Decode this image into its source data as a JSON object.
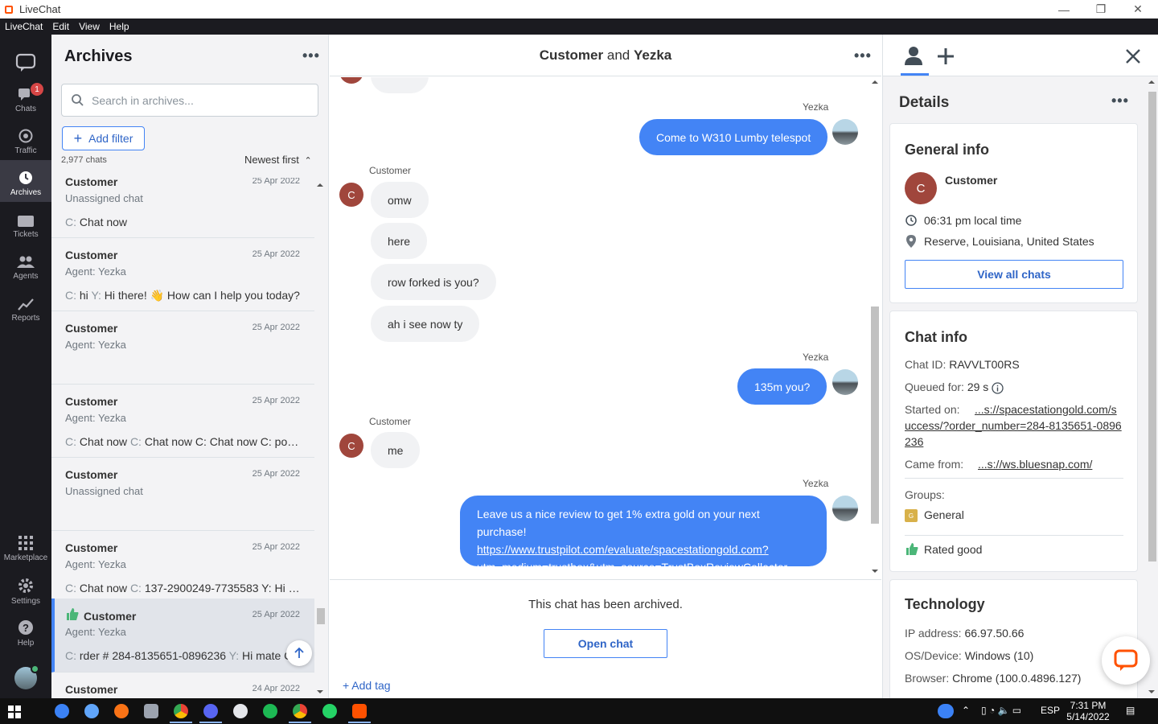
{
  "window": {
    "title": "LiveChat",
    "controls": [
      "—",
      "❐",
      "✕"
    ]
  },
  "menu": [
    "LiveChat",
    "Edit",
    "View",
    "Help"
  ],
  "nav": {
    "items": [
      {
        "label": "Chats",
        "badge": "1"
      },
      {
        "label": "Traffic"
      },
      {
        "label": "Archives"
      },
      {
        "label": "Tickets"
      },
      {
        "label": "Agents"
      },
      {
        "label": "Reports"
      },
      {
        "label": "Marketplace"
      },
      {
        "label": "Settings"
      },
      {
        "label": "Help"
      }
    ],
    "active": "Archives"
  },
  "archives": {
    "title": "Archives",
    "menu_dots": "•••",
    "search_placeholder": "Search in archives...",
    "add_filter": "Add filter",
    "count": "2,977 chats",
    "sort": "Newest first",
    "rows": [
      {
        "name": "Customer",
        "date": "25 Apr 2022",
        "sub": "Unassigned chat",
        "msg_who": "C:",
        "msg": "Chat now"
      },
      {
        "name": "Customer",
        "date": "25 Apr 2022",
        "sub": "Agent: Yezka",
        "msg_who": "C:",
        "msg": "hi",
        "msg_who2": "Y:",
        "msg2": "Hi there! 👋 How can I help you today?"
      },
      {
        "name": "Customer",
        "date": "25 Apr 2022",
        "sub": "Agent: Yezka",
        "msg_who": "",
        "msg": ""
      },
      {
        "name": "Customer",
        "date": "25 Apr 2022",
        "sub": "Agent: Yezka",
        "msg_who": "C:",
        "msg": "Chat now",
        "msg_who2": "C:",
        "msg2": "Chat now C: Chat now C: poo..."
      },
      {
        "name": "Customer",
        "date": "25 Apr 2022",
        "sub": "Unassigned chat",
        "msg_who": "",
        "msg": ""
      },
      {
        "name": "Customer",
        "date": "25 Apr 2022",
        "sub": "Agent: Yezka",
        "msg_who": "C:",
        "msg": "Chat now",
        "msg_who2": "C:",
        "msg2": "137-2900249-7735583 Y: Hi si..."
      },
      {
        "name": "Customer",
        "date": "25 Apr 2022",
        "sub": "Agent: Yezka",
        "msg_who": "C:",
        "msg": "rder # 284-8135651-0896236",
        "msg_who2": "Y:",
        "msg2": "Hi mate C:"
      },
      {
        "name": "Customer",
        "date": "24 Apr 2022",
        "sub": "",
        "msg_who": "",
        "msg": ""
      }
    ]
  },
  "chat": {
    "header_customer": "Customer",
    "header_and": "and",
    "header_agent": "Yezka",
    "messages": {
      "agent_name": "Yezka",
      "customer_name": "Customer",
      "m1": "Come to W310 Lumby telespot",
      "m2": "omw",
      "m3": "here",
      "m4": "row forked is you?",
      "m5": "ah i see now ty",
      "m6": "135m you?",
      "m7": "me",
      "m8_text": "Leave us a nice review to get 1% extra gold on your next purchase!",
      "m8_link1": "https://www.trustpilot.com/evaluate/spacestationgold.com?",
      "m8_link2": "utm_medium=trustbox&utm_source=TrustBoxReviewCollector",
      "avatar_letter": "C"
    },
    "archived_text": "This chat has been archived.",
    "open_chat": "Open chat",
    "add_tag": "+ Add tag"
  },
  "details": {
    "title": "Details",
    "general": {
      "title": "General info",
      "name": "Customer",
      "local_time": "06:31 pm local time",
      "location": "Reserve, Louisiana, United States",
      "view_all": "View all chats"
    },
    "chat_info": {
      "title": "Chat info",
      "chat_id_label": "Chat ID:",
      "chat_id": "RAVVLT00RS",
      "queued_label": "Queued for:",
      "queued": "29 s",
      "started_label": "Started on:",
      "started_1": "...s://spacestationgold.com/s",
      "started_2": "uccess/?order_number=284-8135651-0896",
      "started_3": "236",
      "came_label": "Came from:",
      "came": "...s://ws.bluesnap.com/",
      "groups_label": "Groups:",
      "group": "General",
      "group_letter": "G",
      "rating": "Rated good"
    },
    "tech": {
      "title": "Technology",
      "ip_label": "IP address:",
      "ip": "66.97.50.66",
      "os_label": "OS/Device:",
      "os": "Windows (10)",
      "browser_label": "Browser:",
      "browser": "Chrome (100.0.4896.127)"
    }
  },
  "taskbar": {
    "lang": "ESP",
    "time": "7:31 PM",
    "date": "5/14/2022"
  },
  "colors": {
    "brand": "#4384f5",
    "nav_bg": "#1b1b20",
    "badge": "#d64646"
  }
}
